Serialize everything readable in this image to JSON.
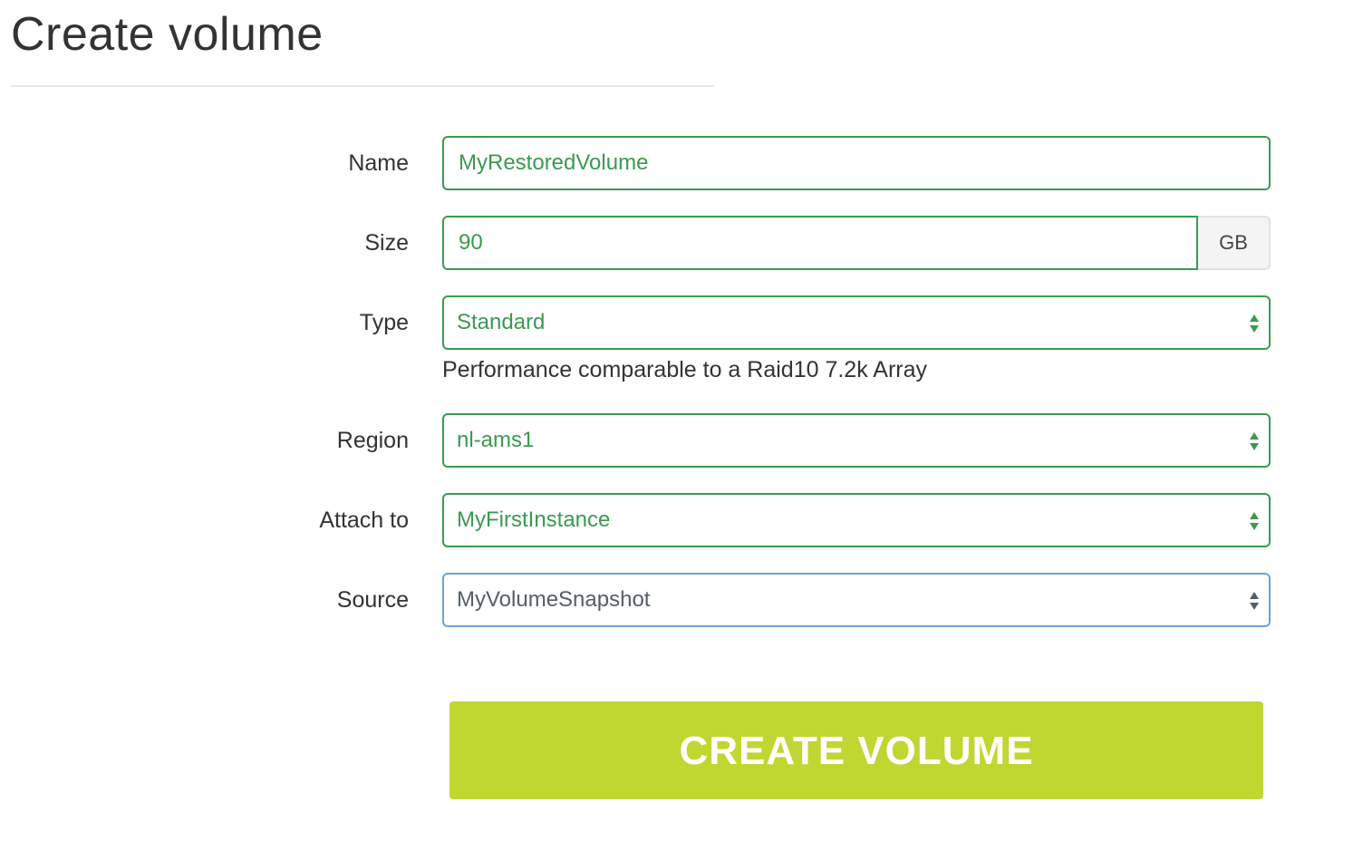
{
  "page": {
    "title": "Create volume"
  },
  "form": {
    "name": {
      "label": "Name",
      "value": "MyRestoredVolume"
    },
    "size": {
      "label": "Size",
      "value": "90",
      "unit": "GB"
    },
    "type": {
      "label": "Type",
      "selected": "Standard",
      "help": "Performance comparable to a Raid10 7.2k Array"
    },
    "region": {
      "label": "Region",
      "selected": "nl-ams1"
    },
    "attach_to": {
      "label": "Attach to",
      "selected": "MyFirstInstance"
    },
    "source": {
      "label": "Source",
      "selected": "MyVolumeSnapshot"
    },
    "submit_label": "CREATE VOLUME"
  },
  "icons": {
    "select_arrows": "up-down-arrows-icon"
  },
  "colors": {
    "valid_border": "#3a9a50",
    "focus_border": "#6ba2d6",
    "button_bg": "#bfd730",
    "button_text": "#ffffff"
  }
}
